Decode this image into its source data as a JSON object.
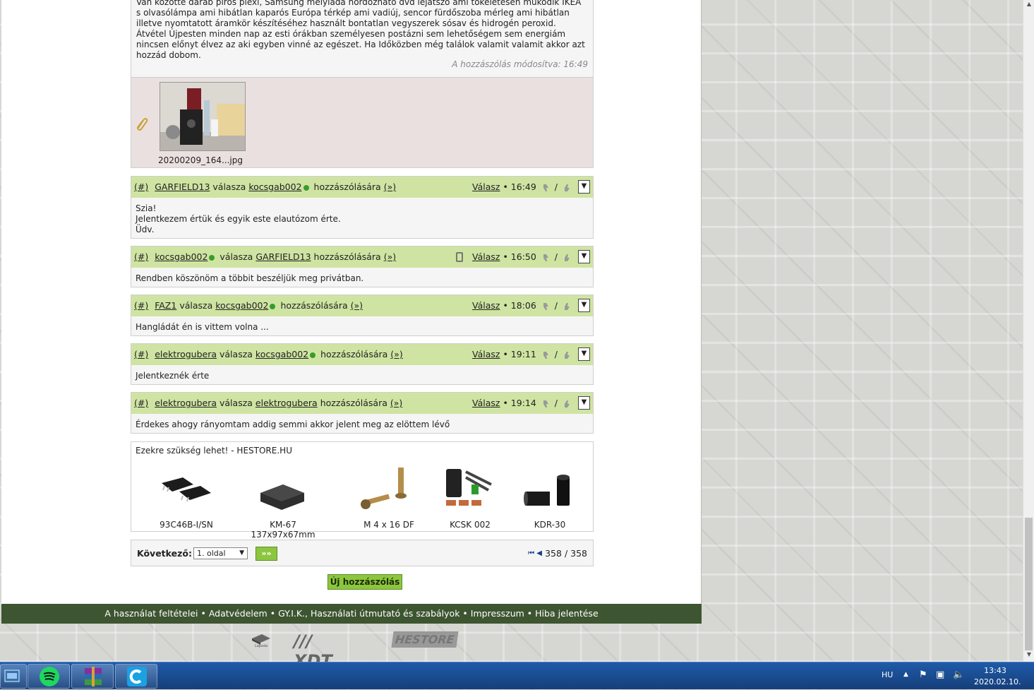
{
  "first_post": {
    "lines": [
      "Van közötte darab piros plexi, Samsung mélyláda hordozható dvd lejátszó ami tökéletesen működik IKEA",
      "s olvasólámpa ami hibátlan kaparós Európa térkép ami vadiúj, sencor fürdőszoba mérleg ami hibátlan",
      "illetve nyomtatott áramkör készítéséhez használt bontatlan vegyszerek sósav és hidrogén peroxid.",
      "Átvétel Újpesten minden nap az esti órákban személyesen postázni sem lehetőségem sem energiám",
      "nincsen előnyt élvez az aki egyben vinné az egészet. Ha Időközben még találok valamit valamit akkor azt",
      "hozzád dobom."
    ],
    "edited": "A hozzászólás módosítva: 16:49",
    "attachment_name": "20200209_164...jpg"
  },
  "posts": [
    {
      "hash": "(#)",
      "author": "GARFIELD13",
      "reply_word": "válasza",
      "target": "kocsgab002",
      "target_online": true,
      "tail": "hozzászólására",
      "link": "(»)",
      "reply": "Válasz",
      "time": "• 16:49",
      "mobile": false,
      "body": "Szia!\nJelentkezem értük és egyik este elautózom érte.\nÜdv."
    },
    {
      "hash": "(#)",
      "author": "kocsgab002",
      "author_online": true,
      "reply_word": "válasza",
      "target": "GARFIELD13",
      "tail": "hozzászólására",
      "link": "(»)",
      "reply": "Válasz",
      "time": "• 16:50",
      "mobile": true,
      "body": "Rendben köszönöm a többit beszéljük meg privátban."
    },
    {
      "hash": "(#)",
      "author": "FAZ1",
      "reply_word": "válasza",
      "target": "kocsgab002",
      "target_online": true,
      "tail": "hozzászólására",
      "link": "(»)",
      "reply": "Válasz",
      "time": "• 18:06",
      "mobile": false,
      "body": "Hangládát én is vittem volna ..."
    },
    {
      "hash": "(#)",
      "author": "elektrogubera",
      "reply_word": "válasza",
      "target": "kocsgab002",
      "target_online": true,
      "tail": "hozzászólására",
      "link": "(»)",
      "reply": "Válasz",
      "time": "• 19:11",
      "mobile": false,
      "body": "Jelentkeznék érte"
    },
    {
      "hash": "(#)",
      "author": "elektrogubera",
      "reply_word": "válasza",
      "target": "elektrogubera",
      "tail": "hozzászólására",
      "link": "(»)",
      "reply": "Válasz",
      "time": "• 19:14",
      "mobile": false,
      "body": "Érdekes ahogy rányomtam addig semmi akkor jelent meg az elöttem lévő"
    }
  ],
  "promo": {
    "title": "Ezekre szükség lehet! - HESTORE.HU",
    "products": [
      "93C46B-I/SN",
      "KM-67 137x97x67mm",
      "M 4 x 16 DF",
      "KCSK 002",
      "KDR-30"
    ]
  },
  "pager": {
    "label": "Következő:",
    "selected": "1. oldal",
    "go": "»»",
    "count": "358 / 358"
  },
  "new_post": "Új hozzászólás",
  "footer": {
    "links": [
      "A használat feltételei",
      "Adatvédelem",
      "GY.I.K., Használati útmutató és szabályok",
      "Impresszum",
      "Hiba jelentése"
    ],
    "separator": " • "
  },
  "logos": [
    "Lapoda",
    "/// XDT",
    "HESTORE"
  ],
  "taskbar": {
    "lang": "HU",
    "time": "13:43",
    "date": "2020.02.10."
  },
  "colors": {
    "post_header": "#cfe4a2",
    "footer": "#3d5530",
    "button": "#8cc63f",
    "online": "#3a9b2a"
  }
}
